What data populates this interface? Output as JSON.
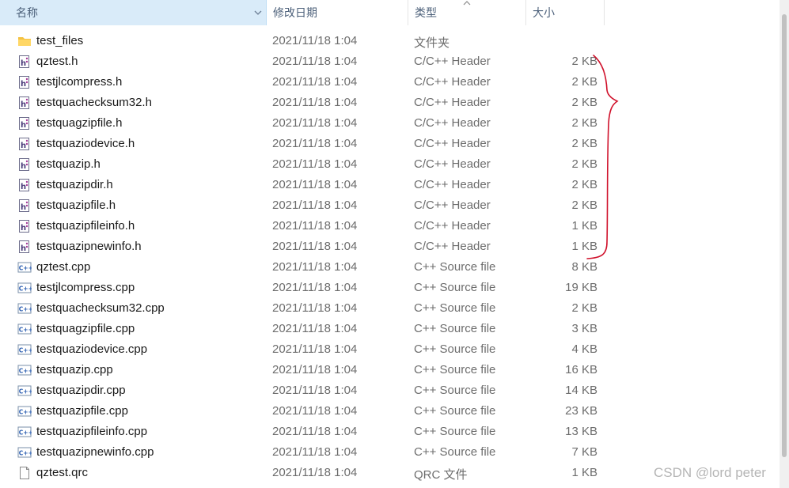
{
  "columns": {
    "name": "名称",
    "date": "修改日期",
    "type": "类型",
    "size": "大小"
  },
  "files": [
    {
      "name": "test_files",
      "date": "2021/11/18 1:04",
      "type": "文件夹",
      "size": "",
      "icon": "folder-icon"
    },
    {
      "name": "qztest.h",
      "date": "2021/11/18 1:04",
      "type": "C/C++ Header",
      "size": "2 KB",
      "icon": "header-file-icon"
    },
    {
      "name": "testjlcompress.h",
      "date": "2021/11/18 1:04",
      "type": "C/C++ Header",
      "size": "2 KB",
      "icon": "header-file-icon"
    },
    {
      "name": "testquachecksum32.h",
      "date": "2021/11/18 1:04",
      "type": "C/C++ Header",
      "size": "2 KB",
      "icon": "header-file-icon"
    },
    {
      "name": "testquagzipfile.h",
      "date": "2021/11/18 1:04",
      "type": "C/C++ Header",
      "size": "2 KB",
      "icon": "header-file-icon"
    },
    {
      "name": "testquaziodevice.h",
      "date": "2021/11/18 1:04",
      "type": "C/C++ Header",
      "size": "2 KB",
      "icon": "header-file-icon"
    },
    {
      "name": "testquazip.h",
      "date": "2021/11/18 1:04",
      "type": "C/C++ Header",
      "size": "2 KB",
      "icon": "header-file-icon"
    },
    {
      "name": "testquazipdir.h",
      "date": "2021/11/18 1:04",
      "type": "C/C++ Header",
      "size": "2 KB",
      "icon": "header-file-icon"
    },
    {
      "name": "testquazipfile.h",
      "date": "2021/11/18 1:04",
      "type": "C/C++ Header",
      "size": "2 KB",
      "icon": "header-file-icon"
    },
    {
      "name": "testquazipfileinfo.h",
      "date": "2021/11/18 1:04",
      "type": "C/C++ Header",
      "size": "1 KB",
      "icon": "header-file-icon"
    },
    {
      "name": "testquazipnewinfo.h",
      "date": "2021/11/18 1:04",
      "type": "C/C++ Header",
      "size": "1 KB",
      "icon": "header-file-icon"
    },
    {
      "name": "qztest.cpp",
      "date": "2021/11/18 1:04",
      "type": "C++ Source file",
      "size": "8 KB",
      "icon": "cpp-file-icon"
    },
    {
      "name": "testjlcompress.cpp",
      "date": "2021/11/18 1:04",
      "type": "C++ Source file",
      "size": "19 KB",
      "icon": "cpp-file-icon"
    },
    {
      "name": "testquachecksum32.cpp",
      "date": "2021/11/18 1:04",
      "type": "C++ Source file",
      "size": "2 KB",
      "icon": "cpp-file-icon"
    },
    {
      "name": "testquagzipfile.cpp",
      "date": "2021/11/18 1:04",
      "type": "C++ Source file",
      "size": "3 KB",
      "icon": "cpp-file-icon"
    },
    {
      "name": "testquaziodevice.cpp",
      "date": "2021/11/18 1:04",
      "type": "C++ Source file",
      "size": "4 KB",
      "icon": "cpp-file-icon"
    },
    {
      "name": "testquazip.cpp",
      "date": "2021/11/18 1:04",
      "type": "C++ Source file",
      "size": "16 KB",
      "icon": "cpp-file-icon"
    },
    {
      "name": "testquazipdir.cpp",
      "date": "2021/11/18 1:04",
      "type": "C++ Source file",
      "size": "14 KB",
      "icon": "cpp-file-icon"
    },
    {
      "name": "testquazipfile.cpp",
      "date": "2021/11/18 1:04",
      "type": "C++ Source file",
      "size": "23 KB",
      "icon": "cpp-file-icon"
    },
    {
      "name": "testquazipfileinfo.cpp",
      "date": "2021/11/18 1:04",
      "type": "C++ Source file",
      "size": "13 KB",
      "icon": "cpp-file-icon"
    },
    {
      "name": "testquazipnewinfo.cpp",
      "date": "2021/11/18 1:04",
      "type": "C++ Source file",
      "size": "7 KB",
      "icon": "cpp-file-icon"
    },
    {
      "name": "qztest.qrc",
      "date": "2021/11/18 1:04",
      "type": "QRC 文件",
      "size": "1 KB",
      "icon": "generic-file-icon"
    }
  ],
  "watermark": "CSDN @lord peter",
  "colors": {
    "header_selected_bg": "#d9ebf9",
    "header_text": "#4c607a",
    "annotation": "#d0112b",
    "folder": "#f7c948"
  }
}
